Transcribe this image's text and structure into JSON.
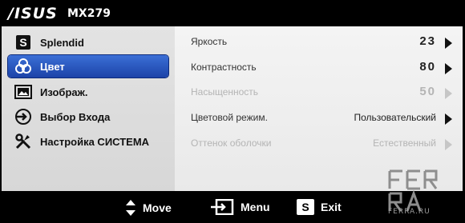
{
  "header": {
    "brand": "/ISUS",
    "model": "MX279"
  },
  "nav": {
    "items": [
      {
        "label": "Splendid",
        "icon": "splendid-s-icon"
      },
      {
        "label": "Цвет",
        "icon": "color-circles-icon",
        "selected": true
      },
      {
        "label": "Изображ.",
        "icon": "image-icon"
      },
      {
        "label": "Выбор Входа",
        "icon": "input-select-icon"
      },
      {
        "label": "Настройка СИСТЕМА",
        "icon": "tools-icon"
      }
    ]
  },
  "settings": {
    "rows": [
      {
        "name": "Яркость",
        "value": "23",
        "enabled": true
      },
      {
        "name": "Контрастность",
        "value": "80",
        "enabled": true
      },
      {
        "name": "Насыщенность",
        "value": "50",
        "enabled": false
      },
      {
        "name": "Цветовой режим.",
        "value": "Пользовательский",
        "enabled": true
      },
      {
        "name": "Оттенок оболочки",
        "value": "Естественный",
        "enabled": false
      }
    ]
  },
  "footer": {
    "move_label": "Move",
    "menu_label": "Menu",
    "exit_label": "Exit",
    "exit_key": "S"
  },
  "watermark": {
    "text": "FERRA.RU"
  },
  "colors": {
    "selected": "#2a57c2",
    "left_panel": "#dcdcdc",
    "right_panel": "#f0f0f0"
  }
}
